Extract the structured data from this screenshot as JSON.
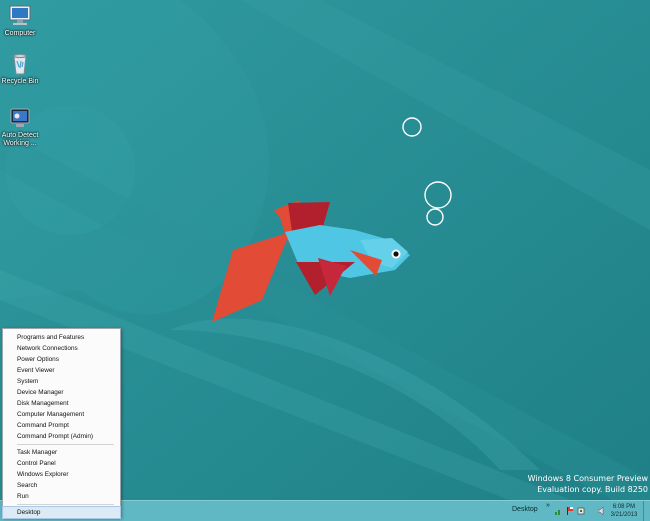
{
  "desktop_icons": [
    {
      "label": "Computer",
      "icon": "computer-icon"
    },
    {
      "label": "Recycle Bin",
      "icon": "recycle-bin-icon"
    },
    {
      "label": "Auto Detect Working ...",
      "icon": "auto-detect-icon"
    }
  ],
  "watermark": {
    "line1": "Windows 8 Consumer Preview",
    "line2": "Evaluation copy. Build 8250"
  },
  "context_menu": {
    "group1": [
      "Programs and Features",
      "Network Connections",
      "Power Options",
      "Event Viewer",
      "System",
      "Device Manager",
      "Disk Management",
      "Computer Management",
      "Command Prompt",
      "Command Prompt (Admin)"
    ],
    "group2": [
      "Task Manager",
      "Control Panel",
      "Windows Explorer",
      "Search",
      "Run"
    ],
    "group3": [
      "Desktop"
    ]
  },
  "taskbar": {
    "toolbar_label": "Desktop",
    "overflow_glyph": "»",
    "tray_icons": [
      "network-icon",
      "action-center-flag-icon",
      "power-icon",
      "volume-icon"
    ],
    "clock_time": "6:08 PM",
    "clock_date": "3/21/2013"
  },
  "colors": {
    "wallpaper": "#2a8f95",
    "taskbar": "#5fb8c3",
    "fish_body": "#4fc6e3",
    "fish_fin_dark": "#b2202e",
    "fish_fin_orange": "#e24b35"
  }
}
